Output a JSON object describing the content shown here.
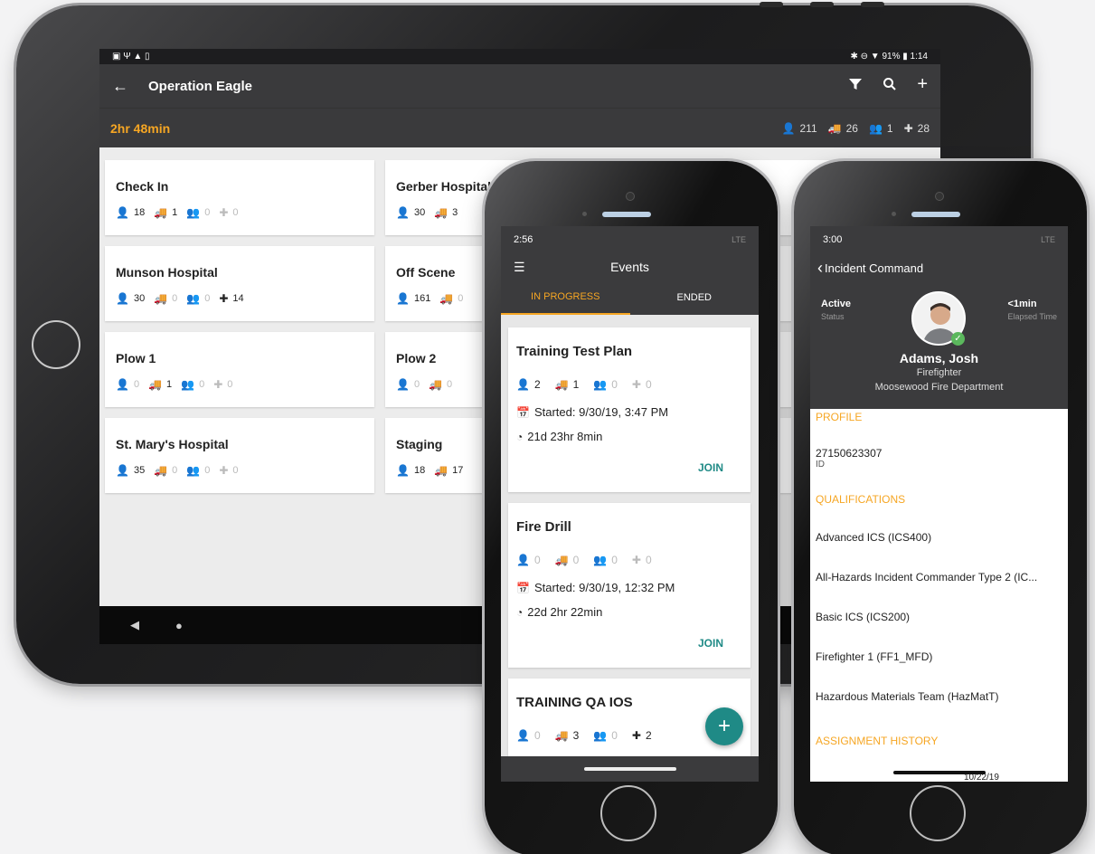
{
  "tablet": {
    "status": {
      "left_icons": "▣ Ψ ▲ ▯",
      "right_text": "✱ ⊖ ▼ 91% ▮ 1:14"
    },
    "title": "Operation Eagle",
    "elapsed": "2hr 48min",
    "stats": {
      "people": "211",
      "vehicles": "26",
      "groups": "1",
      "kits": "28"
    },
    "cards": [
      {
        "name": "Check In",
        "people": "18",
        "vehicles": "1",
        "groups": "0",
        "kits": "0"
      },
      {
        "name": "Gerber Hospital",
        "people": "30",
        "vehicles": "3",
        "groups": "",
        "kits": ""
      },
      {
        "name": "Munson Hospital",
        "people": "30",
        "vehicles": "0",
        "groups": "0",
        "kits": "14"
      },
      {
        "name": "Off Scene",
        "people": "161",
        "vehicles": "0",
        "groups": "",
        "kits": ""
      },
      {
        "name": "Plow 1",
        "people": "0",
        "vehicles": "1",
        "groups": "0",
        "kits": "0"
      },
      {
        "name": "Plow 2",
        "people": "0",
        "vehicles": "0",
        "groups": "",
        "kits": ""
      },
      {
        "name": "St. Mary's Hospital",
        "people": "35",
        "vehicles": "0",
        "groups": "0",
        "kits": "0"
      },
      {
        "name": "Staging",
        "people": "18",
        "vehicles": "17",
        "groups": "",
        "kits": ""
      }
    ]
  },
  "events_phone": {
    "time": "2:56",
    "signal": "LTE",
    "title": "Events",
    "tabs": [
      "IN PROGRESS",
      "ENDED"
    ],
    "cards": [
      {
        "name": "Training Test Plan",
        "people": "2",
        "vehicles": "1",
        "groups": "0",
        "kits": "0",
        "started": "Started: 9/30/19, 3:47 PM",
        "duration": "21d 23hr 8min",
        "action": "JOIN"
      },
      {
        "name": "Fire Drill",
        "people": "0",
        "vehicles": "0",
        "groups": "0",
        "kits": "0",
        "started": "Started: 9/30/19, 12:32 PM",
        "duration": "22d 2hr 22min",
        "action": "JOIN"
      },
      {
        "name": "TRAINING QA IOS",
        "people": "0",
        "vehicles": "3",
        "groups": "0",
        "kits": "2"
      }
    ],
    "fab": "+"
  },
  "incident_phone": {
    "time": "3:00",
    "signal": "LTE",
    "back_label": "Incident Command",
    "status_value": "Active",
    "status_label": "Status",
    "elapsed_value": "<1min",
    "elapsed_label": "Elapsed Time",
    "name": "Adams, Josh",
    "role": "Firefighter",
    "department": "Moosewood Fire Department",
    "profile_header": "PROFILE",
    "id_value": "27150623307",
    "id_label": "ID",
    "qualifications_header": "QUALIFICATIONS",
    "qualifications": [
      "Advanced ICS (ICS400)",
      "All-Hazards Incident Commander Type 2 (IC...",
      "Basic ICS (ICS200)",
      "Firefighter 1 (FF1_MFD)",
      "Hazardous Materials Team (HazMatT)"
    ],
    "history_header": "ASSIGNMENT HISTORY",
    "history_date": "10/22/19"
  }
}
